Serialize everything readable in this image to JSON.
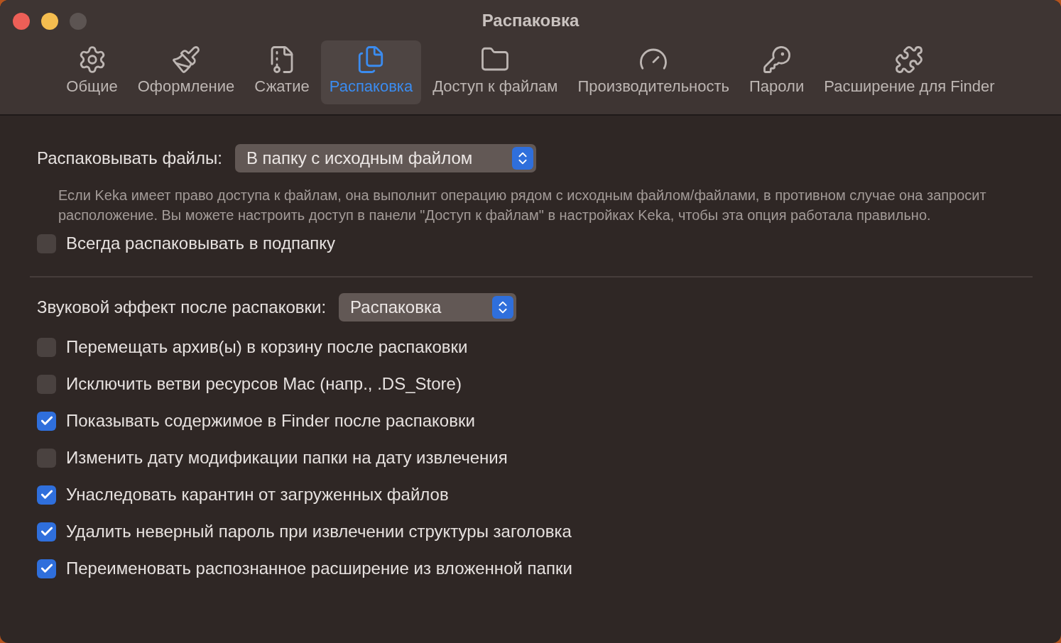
{
  "window": {
    "title": "Распаковка"
  },
  "toolbar": [
    {
      "label": "Общие",
      "selected": false
    },
    {
      "label": "Оформление",
      "selected": false
    },
    {
      "label": "Сжатие",
      "selected": false
    },
    {
      "label": "Распаковка",
      "selected": true
    },
    {
      "label": "Доступ к файлам",
      "selected": false
    },
    {
      "label": "Производительность",
      "selected": false
    },
    {
      "label": "Пароли",
      "selected": false
    },
    {
      "label": "Расширение для Finder",
      "selected": false
    }
  ],
  "extract_to": {
    "label": "Распаковывать файлы:",
    "value": "В папку с исходным файлом"
  },
  "description": "Если Keka имеет право доступа к файлам, она выполнит операцию рядом с исходным файлом/файлами, в противном случае она запросит расположение. Вы можете настроить доступ в панели \"Доступ к файлам\" в настройках Keka, чтобы эта опция работала правильно.",
  "always_subfolder": {
    "label": "Всегда распаковывать в подпапку",
    "checked": false
  },
  "sound": {
    "label": "Звуковой эффект после распаковки:",
    "value": "Распаковка"
  },
  "options": [
    {
      "label": "Перемещать архив(ы) в корзину после распаковки",
      "checked": false
    },
    {
      "label": "Исключить ветви ресурсов Mac (напр., .DS_Store)",
      "checked": false
    },
    {
      "label": "Показывать содержимое в Finder после распаковки",
      "checked": true
    },
    {
      "label": "Изменить дату модификации папки на дату извлечения",
      "checked": false
    },
    {
      "label": "Унаследовать карантин от загруженных файлов",
      "checked": true
    },
    {
      "label": "Удалить неверный пароль при извлечении структуры заголовка",
      "checked": true
    },
    {
      "label": "Переименовать распознанное расширение из вложенной папки",
      "checked": true
    }
  ]
}
